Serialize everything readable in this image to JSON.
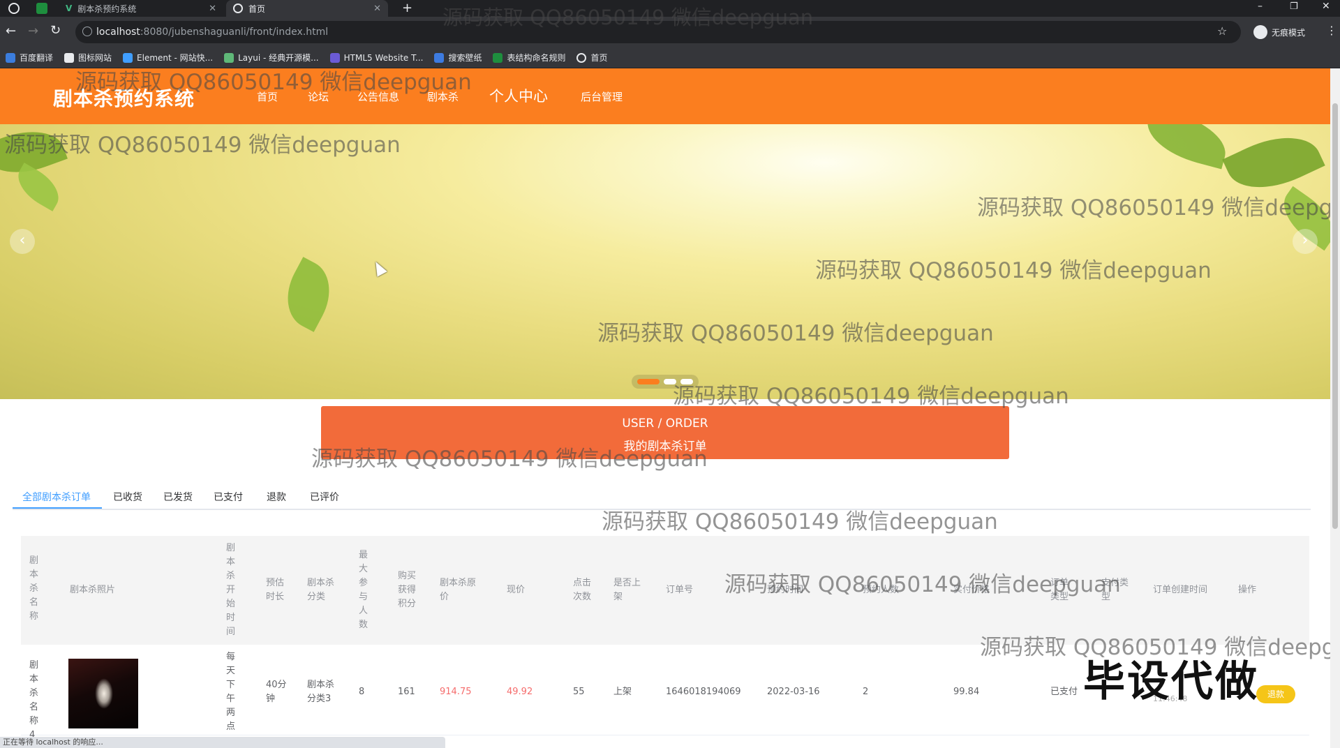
{
  "browser": {
    "tabs": [
      {
        "label": "剧本杀预约系统",
        "active": false
      },
      {
        "label": "首页",
        "active": true
      }
    ],
    "url_host": "localhost",
    "url_path": ":8080/jubenshaguanli/front/index.html",
    "profile_label": "无痕模式",
    "bookmarks": [
      "百度翻译",
      "图标网站",
      "Element - 网站快...",
      "Layui - 经典开源模...",
      "HTML5 Website T...",
      "搜索壁纸",
      "表结构命名规则",
      "首页"
    ],
    "status_text": "正在等待 localhost 的响应..."
  },
  "site": {
    "title": "剧本杀预约系统",
    "nav": [
      "首页",
      "论坛",
      "公告信息",
      "剧本杀",
      "个人中心",
      "后台管理"
    ]
  },
  "banner": {
    "prev_symbol": "‹",
    "next_symbol": "›"
  },
  "order_banner": {
    "en": "USER / ORDER",
    "zh": "我的剧本杀订单"
  },
  "order_tabs": [
    "全部剧本杀订单",
    "已收货",
    "已发货",
    "已支付",
    "退款",
    "已评价"
  ],
  "table": {
    "headers": [
      "剧本杀名称",
      "剧本杀照片",
      "剧本杀开始时间",
      "预估时长",
      "剧本杀分类",
      "最大参与人数",
      "购买获得积分",
      "剧本杀原价",
      "现价",
      "点击次数",
      "是否上架",
      "订单号",
      "预约时间",
      "预约人数",
      "实付价格",
      "订单类型",
      "支付类型",
      "订单创建时间",
      "操作"
    ],
    "row": {
      "name": "剧本杀名称4",
      "start_time": "每天下午两点",
      "duration": "40分钟",
      "category": "剧本杀分类3",
      "max_people": "8",
      "points": "161",
      "original_price": "914.75",
      "price": "49.92",
      "clicks": "55",
      "listed": "上架",
      "order_no": "1646018194069",
      "reserve_date": "2022-03-16",
      "reserve_count": "2",
      "paid": "99.84",
      "order_type": "已支付",
      "created_time_fragment": "11:46:48",
      "action": "退款"
    }
  },
  "watermark": "源码获取 QQ86050149 微信deepguan",
  "corner_stamp": "毕设代做"
}
